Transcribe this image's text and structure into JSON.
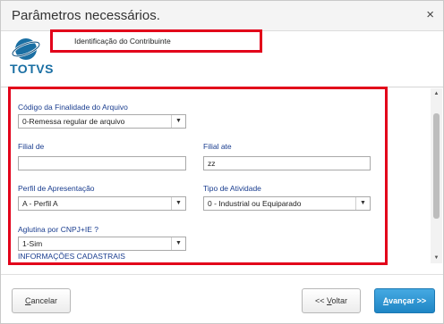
{
  "window": {
    "title": "Parâmetros necessários.",
    "close_glyph": "×"
  },
  "brand": {
    "logo_text": "TOTVS",
    "logo_colors": [
      "#1a6fa3",
      "#0f4f7d"
    ]
  },
  "header": {
    "label": "Identificação do Contribuinte"
  },
  "form": {
    "finalidade": {
      "label": "Código da Finalidade do Arquivo",
      "value": "0-Remessa regular de arquivo"
    },
    "filial_de": {
      "label": "Filial de",
      "value": ""
    },
    "filial_ate": {
      "label": "Filial ate",
      "value": "zz"
    },
    "perfil": {
      "label": "Perfil de Apresentação",
      "value": "A - Perfil A"
    },
    "atividade": {
      "label": "Tipo de Atividade",
      "value": "0 - Industrial ou Equiparado"
    },
    "aglutina": {
      "label": "Aglutina por CNPJ+IE ?",
      "value": "1-Sim"
    },
    "section_cadastrais": "INFORMAÇÕES CADASTRAIS"
  },
  "footer": {
    "cancel_first": "C",
    "cancel_rest": "ancelar",
    "back_prefix": "<< ",
    "back_u": "V",
    "back_rest": "oltar",
    "next_u": "A",
    "next_rest": "vançar >>"
  },
  "colors": {
    "highlight": "#e2001a",
    "label_blue": "#1a3d8f",
    "primary_button": "#1f86c5"
  },
  "icons": {
    "dropdown": "chevron-down-icon",
    "close": "close-icon"
  }
}
